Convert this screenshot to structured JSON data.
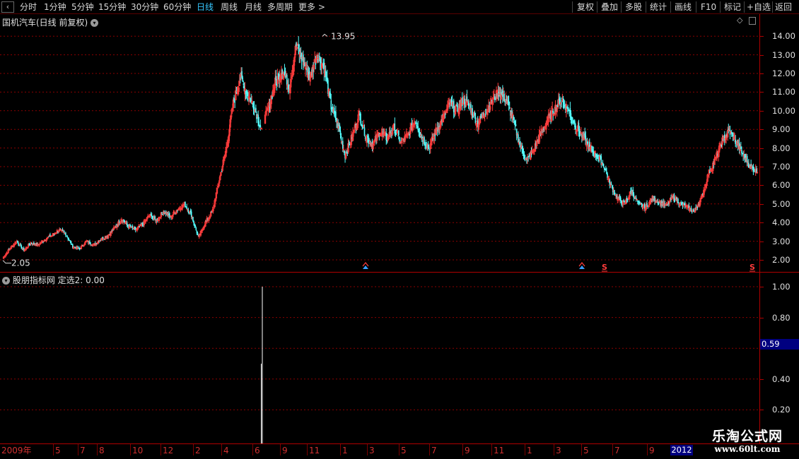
{
  "toolbar": {
    "back_icon": "back-arrow-icon",
    "left_items": [
      "分时",
      "1分钟",
      "5分钟",
      "15分钟",
      "30分钟",
      "60分钟",
      "日线",
      "周线",
      "月线",
      "多周期",
      "更多 >"
    ],
    "active_index": 6,
    "right_items": [
      "复权",
      "叠加",
      "多股",
      "统计",
      "画线",
      "F10",
      "标记",
      "+自选",
      "返回"
    ]
  },
  "main_panel": {
    "title": "国机汽车(日线 前复权)",
    "y_ticks": [
      "14.00",
      "13.00",
      "12.00",
      "11.00",
      "10.00",
      "9.00",
      "8.00",
      "7.00",
      "6.00",
      "5.00",
      "4.00",
      "3.00",
      "2.00"
    ],
    "high_label": "13.95",
    "low_label": "2.05"
  },
  "indicator_panel": {
    "title": "股朋指标网",
    "series_label": "定选2: 0.00",
    "y_ticks": [
      "1.00",
      "0.80",
      "0.59",
      "0.40",
      "0.20"
    ],
    "current_value": "0.59"
  },
  "date_axis": {
    "labels": [
      "2009年",
      "5",
      "7",
      "8",
      "10",
      "12",
      "2",
      "4",
      "6",
      "9",
      "11",
      "1",
      "3",
      "5",
      "7",
      "9",
      "11",
      "1",
      "3",
      "5",
      "7",
      "9"
    ],
    "end_label": "2012"
  },
  "watermark": {
    "title": "乐淘公式网",
    "url": "www.60lt.com"
  },
  "colors": {
    "up": "#ff3c3c",
    "down": "#54ffff",
    "grid": "#8b0000",
    "frame": "#b00000",
    "axis_text": "#e0e0e0",
    "badge": "#000080"
  },
  "chart_data": [
    {
      "type": "candlestick",
      "title": "国机汽车(日线 前复权)",
      "ylim": [
        1.6,
        14.6
      ],
      "y_ticks": [
        2,
        3,
        4,
        5,
        6,
        7,
        8,
        9,
        10,
        11,
        12,
        13,
        14
      ],
      "max_close_marker": 13.95,
      "min_marker": 2.05,
      "series": [
        {
          "values": [
            2.1,
            2.6,
            3.0,
            2.5,
            2.9,
            2.8,
            3.1,
            3.3,
            3.6,
            3.4,
            2.7,
            2.6,
            3.0,
            2.8,
            3.1,
            3.3,
            3.7,
            4.2,
            3.8,
            3.6,
            3.9,
            4.4,
            4.1,
            4.6,
            4.3,
            4.7,
            5.0,
            4.4,
            3.2,
            4.0,
            4.6,
            6.3,
            8.0,
            10.4,
            11.8,
            10.9,
            10.2,
            9.0,
            10.1,
            11.5,
            12.2,
            11.3,
            13.5,
            12.6,
            11.8,
            13.0,
            12.3,
            10.2,
            9.2,
            7.6,
            8.6,
            9.8,
            8.6,
            8.2,
            8.9,
            8.5,
            9.1,
            8.3,
            8.7,
            9.5,
            8.6,
            8.0,
            8.9,
            9.6,
            10.4,
            10.0,
            10.6,
            10.1,
            9.3,
            9.9,
            10.5,
            11.0,
            10.6,
            9.6,
            8.2,
            7.3,
            7.9,
            8.8,
            9.5,
            10.1,
            10.6,
            10.0,
            9.2,
            8.6,
            8.0,
            7.6,
            7.1,
            6.0,
            5.3,
            5.0,
            5.7,
            5.0,
            4.8,
            5.3,
            5.1,
            4.9,
            5.4,
            5.0,
            4.8,
            4.6,
            5.3,
            6.6,
            7.4,
            8.4,
            8.9,
            8.3,
            7.6,
            7.0,
            6.7
          ]
        }
      ],
      "signals": [
        {
          "type": "buy",
          "label": "▲"
        },
        {
          "type": "buy",
          "label": "▲"
        },
        {
          "type": "sell",
          "label": "S"
        },
        {
          "type": "sell",
          "label": "S"
        }
      ]
    },
    {
      "type": "bar",
      "title": "定选2",
      "ylim": [
        0.06,
        1.08
      ],
      "y_ticks": [
        0.2,
        0.4,
        0.59,
        0.8,
        1.0
      ],
      "spike_values": [
        1.0,
        0.5
      ],
      "other_values": 0.0
    }
  ]
}
